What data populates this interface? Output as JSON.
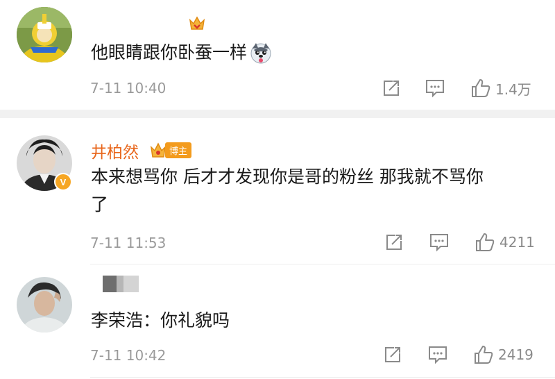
{
  "comments": [
    {
      "name": "",
      "text": "他眼睛跟你卧蚕一样",
      "emoji_icon": "husky-face-icon",
      "time": "7-11 10:40",
      "likes": "1.4万",
      "badge_icon": "gold-crown-icon"
    },
    {
      "name": "井柏然",
      "badge": "博主",
      "verified_mark": "V",
      "text_line1": "本来想骂你 后才才发现你是哥的粉丝 那我就不骂你",
      "text_line2": "了",
      "time": "7-11 11:53",
      "likes": "4211"
    },
    {
      "name": "",
      "text": "李荣浩：你礼貌吗",
      "time": "7-11 10:42",
      "likes": "2419"
    }
  ],
  "icons": {
    "repost": "repost-icon",
    "comment": "comment-icon",
    "like": "thumbs-up-icon"
  },
  "colors": {
    "name_orange": "#e8661b",
    "meta_gray": "#9a9a9a",
    "separator": "#f1f1f1"
  }
}
